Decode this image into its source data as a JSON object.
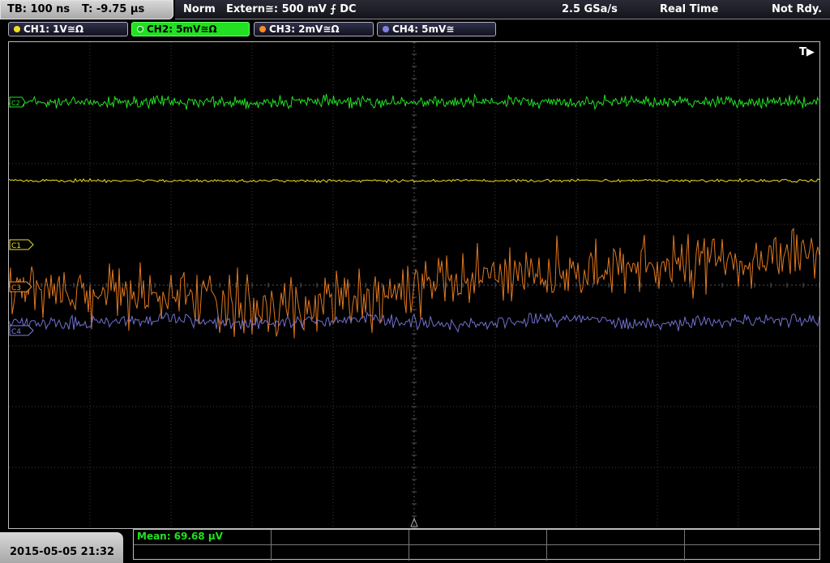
{
  "top": {
    "timebase": "TB: 100 ns",
    "trigger_time": "T: -9.75 µs",
    "trigger_mode": "Norm",
    "trigger_source": "Extern≅: 500 mV ⨍ DC",
    "sample_rate": "2.5 GSa/s",
    "acq_mode": "Real Time",
    "status": "Not Rdy."
  },
  "channels": [
    {
      "label": "CH1: 1V≅Ω",
      "color": "#f0e020",
      "active": false
    },
    {
      "label": "CH2: 5mV≅Ω",
      "color": "#22e022",
      "active": true
    },
    {
      "label": "CH3: 2mV≅Ω",
      "color": "#ff8c2a",
      "active": false
    },
    {
      "label": "CH4: 5mV≅",
      "color": "#8080e0",
      "active": false
    }
  ],
  "markers": {
    "c1": "C1",
    "c3": "C3",
    "c4": "C4",
    "c2": "C2",
    "trigger": "T▶"
  },
  "traces": {
    "ch2_color": "#22e022",
    "ch1_color": "#f0e020",
    "ch3_color": "#e07820",
    "ch4_color": "#7070d0"
  },
  "footer": {
    "datetime": "2015-05-05 21:32",
    "measurement": "Mean: 69.68 µV"
  }
}
